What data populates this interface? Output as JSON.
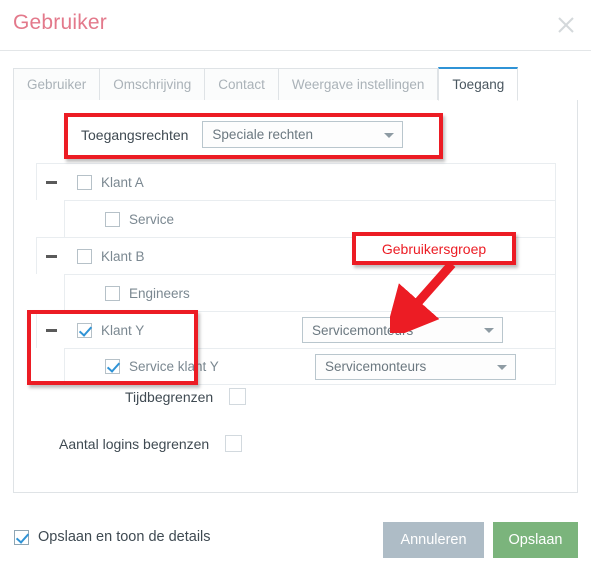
{
  "header": {
    "title": "Gebruiker",
    "close_icon": "close-icon"
  },
  "tabs": [
    {
      "label": "Gebruiker",
      "active": false
    },
    {
      "label": "Omschrijving",
      "active": false
    },
    {
      "label": "Contact",
      "active": false
    },
    {
      "label": "Weergave instellingen",
      "active": false
    },
    {
      "label": "Toegang",
      "active": true
    }
  ],
  "access_rights": {
    "label": "Toegangsrechten",
    "selected": "Speciale rechten",
    "caret_icon": "chevron-down-icon"
  },
  "tree": {
    "rows": [
      {
        "label": "Klant A",
        "level": 0,
        "checked": false,
        "expander": true,
        "group": null
      },
      {
        "label": "Service",
        "level": 1,
        "checked": false,
        "expander": false,
        "group": null
      },
      {
        "label": "Klant B",
        "level": 0,
        "checked": false,
        "expander": true,
        "group": null
      },
      {
        "label": "Engineers",
        "level": 1,
        "checked": false,
        "expander": false,
        "group": null
      },
      {
        "label": "Klant Y",
        "level": 0,
        "checked": true,
        "expander": true,
        "group": "Servicemonteurs"
      },
      {
        "label": "Service klant Y",
        "level": 1,
        "checked": true,
        "expander": false,
        "group": "Servicemonteurs"
      }
    ]
  },
  "limits": {
    "time_label": "Tijdbegrenzen",
    "time_checked": false,
    "logins_label": "Aantal logins begrenzen",
    "logins_checked": false
  },
  "footer": {
    "save_details_label": "Opslaan en toon de details",
    "save_details_checked": true,
    "cancel_label": "Annuleren",
    "save_label": "Opslaan"
  },
  "annotations": {
    "callout_label": "Gebruikersgroep",
    "color": "#EC1C24"
  },
  "colors": {
    "title": "#E3798B",
    "tab_active_underline": "#2F93D6",
    "checkbox_check": "#2F93D6",
    "save_button": "#7BB47C",
    "cancel_button": "#AEBCC6",
    "annotation_red": "#EC1C24"
  }
}
